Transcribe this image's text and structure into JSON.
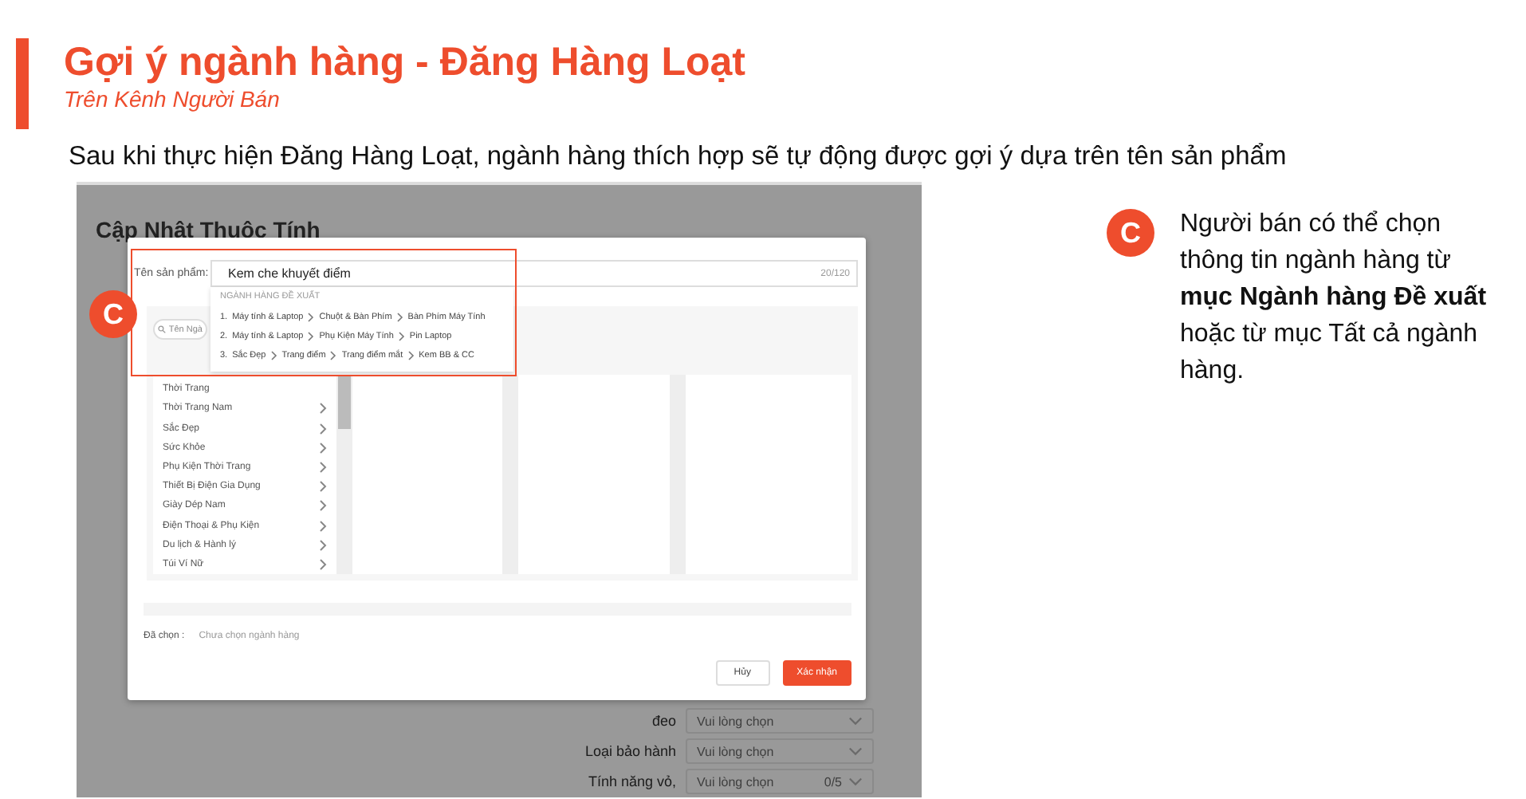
{
  "header": {
    "title": "Gợi ý ngành hàng - Đăng Hàng Loạt",
    "subtitle": "Trên Kênh Người Bán"
  },
  "intro": "Sau khi thực hiện Đăng Hàng Loạt, ngành hàng thích hợp sẽ tự động được gợi ý dựa trên tên sản phẩm",
  "screenshot": {
    "page_title": "Cập Nhật Thuộc Tính",
    "attributes": [
      {
        "label": "đeo",
        "placeholder": "Vui lòng chọn"
      },
      {
        "label": "Loại bảo hành",
        "placeholder": "Vui lòng chọn"
      },
      {
        "label": "Tính năng vỏ,",
        "placeholder": "Vui lòng chọn",
        "counter": "0/5"
      }
    ],
    "modal": {
      "name_label": "Tên sản phẩm:",
      "name_value": "Kem che khuyết điểm",
      "name_counter": "20/120",
      "suggestions": {
        "heading": "NGÀNH HÀNG ĐỀ XUẤT",
        "items": [
          {
            "index": "1.",
            "path": [
              "Máy tính & Laptop",
              "Chuột & Bàn Phím",
              "Bàn Phím Máy Tính"
            ]
          },
          {
            "index": "2.",
            "path": [
              "Máy tính & Laptop",
              "Phụ Kiện Máy Tính",
              "Pin Laptop"
            ]
          },
          {
            "index": "3.",
            "path": [
              "Sắc Đẹp",
              "Trang điểm",
              "Trang điểm mắt",
              "Kem BB & CC"
            ]
          }
        ]
      },
      "search_placeholder": "Tên Ngà",
      "categories": [
        "Thời Trang",
        "Thời Trang Nam",
        "Sắc Đẹp",
        "Sức Khỏe",
        "Phụ Kiện Thời Trang",
        "Thiết Bị Điện Gia Dụng",
        "Giày Dép Nam",
        "Điện Thoại & Phụ Kiện",
        "Du lịch & Hành lý",
        "Túi Ví Nữ"
      ],
      "chosen_label": "Đã chọn :",
      "chosen_value": "Chưa chọn ngành hàng",
      "buttons": [
        {
          "label": "Hủy",
          "kind": "secondary"
        },
        {
          "label": "Xác nhận",
          "kind": "primary"
        }
      ]
    },
    "marker": "C"
  },
  "callout": {
    "marker": "C",
    "text": "Người bán có thể chọn thông tin ngành hàng từ **mục Ngành hàng Đề xuất** hoặc từ mục Tất cả ngành hàng."
  }
}
